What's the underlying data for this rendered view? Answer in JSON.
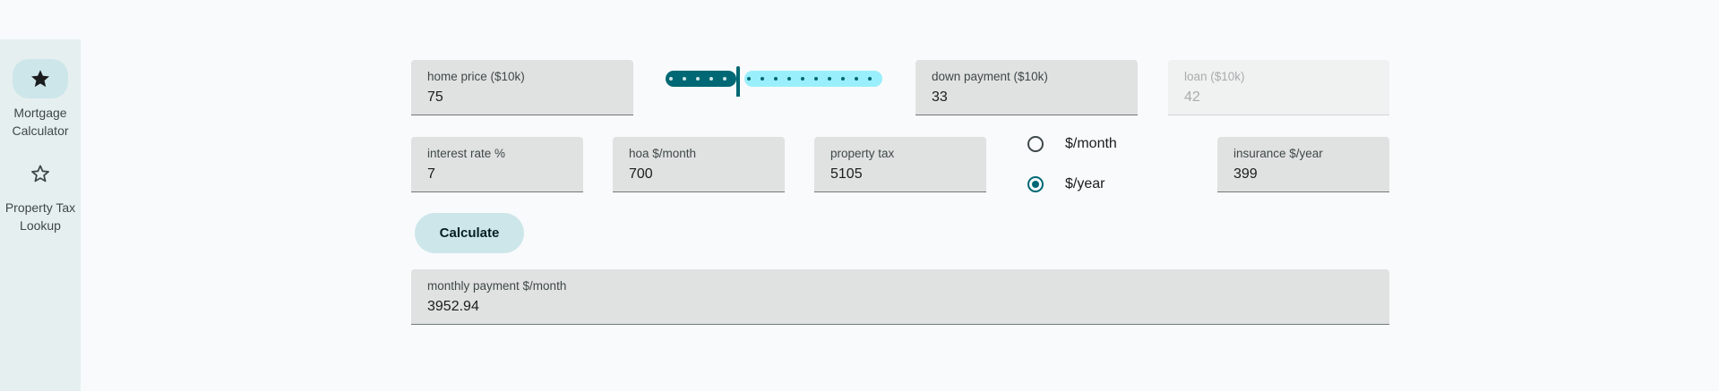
{
  "nav": {
    "items": [
      {
        "label_line1": "Mortgage",
        "label_line2": "Calculator",
        "icon": "star-filled-icon",
        "active": true
      },
      {
        "label_line1": "Property Tax",
        "label_line2": "Lookup",
        "icon": "star-outline-icon",
        "active": false
      }
    ]
  },
  "form": {
    "home_price": {
      "label": "home price ($10k)",
      "value": "75"
    },
    "down_payment": {
      "label": "down payment ($10k)",
      "value": "33"
    },
    "loan": {
      "label": "loan ($10k)",
      "value": "42"
    },
    "interest_rate": {
      "label": "interest rate %",
      "value": "7"
    },
    "hoa": {
      "label": "hoa $/month",
      "value": "700"
    },
    "property_tax": {
      "label": "property tax",
      "value": "5105"
    },
    "tax_period": {
      "options": [
        "$/month",
        "$/year"
      ],
      "selected": "$/year"
    },
    "insurance": {
      "label": "insurance $/year",
      "value": "399"
    },
    "down_payment_slider": {
      "fraction": 0.33
    }
  },
  "actions": {
    "calculate_label": "Calculate"
  },
  "result": {
    "monthly_payment": {
      "label": "monthly payment $/month",
      "value": "3952.94"
    }
  },
  "colors": {
    "primary": "#006874",
    "primary_container": "#cde6ea",
    "slider_inactive": "#9aeffd",
    "field_fill": "#e0e2e1",
    "nav_background": "#e6eff0"
  }
}
